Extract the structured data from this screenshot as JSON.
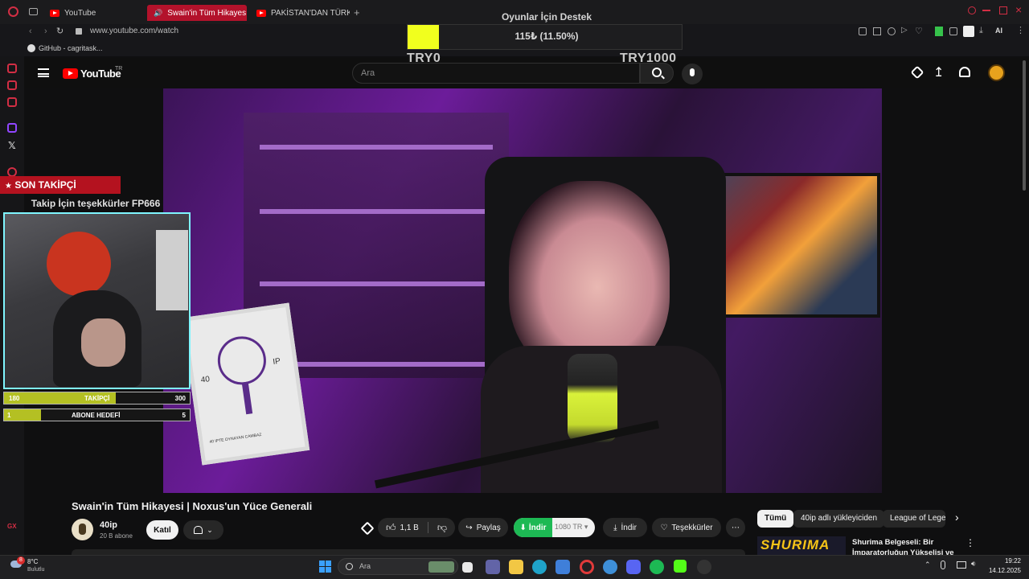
{
  "browser": {
    "tabs": [
      {
        "label": "YouTube"
      },
      {
        "label": "Swain'in Tüm Hikayes"
      },
      {
        "label": "PAKİSTAN'DAN TÜRKİYE"
      }
    ],
    "url": "www.youtube.com/watch",
    "bookmark": "GitHub - cagritask...",
    "ai_label": "AI"
  },
  "donation": {
    "title": "Oyunlar İçin Destek",
    "amount": "115₺ (11.50%)",
    "min_label": "TRY0",
    "max_label": "TRY1000",
    "progress": 0.115
  },
  "youtube": {
    "logo": "YouTube",
    "logo_suffix": "TR",
    "search_placeholder": "Ara"
  },
  "overlay": {
    "banner": "SON TAKİPÇİ",
    "message": "Takip İçin teşekkürler FP666",
    "followers_goal": {
      "current": "180",
      "label": "TAKİPÇİ",
      "target": "300",
      "progress": 0.6
    },
    "sub_goal": {
      "current": "1",
      "label": "ABONE HEDEFİ",
      "target": "5",
      "progress": 0.2
    }
  },
  "video": {
    "poster_left": "40",
    "poster_right": "IP",
    "poster_caption": "40 IPTE OYNAYAN CAMBAZ",
    "title": "Swain'in Tüm Hikayesi | Noxus'un Yüce Generali",
    "channel": "40ip",
    "subscribers": "20 B abone",
    "join_label": "Katıl",
    "likes": "1,1 B",
    "share_label": "Paylaş",
    "download_green": "İndir",
    "quality": "1080",
    "quality_lang": "TR",
    "download_label": "İndir",
    "thanks_label": "Teşekkürler"
  },
  "recommendations": {
    "chips": [
      "Tümü",
      "40ip adlı yükleyiciden",
      "League of Legen"
    ],
    "first_title_line1": "Shurima Belgeseli: Bir",
    "first_title_line2": "İmparatorluğun Yükselişi ve",
    "thumb_text": "SHURIMA"
  },
  "taskbar": {
    "weather_temp": "8°C",
    "weather_desc": "Bulutlu",
    "weather_badge": "8",
    "search_placeholder": "Ara",
    "time": "19:22",
    "date": "14.12.2025"
  },
  "colors": {
    "accent_red": "#ff0000",
    "opera_red": "#d22e44",
    "donation_yellow": "#f1ff1e",
    "download_green": "#1db954",
    "cam_border": "#7ff6ff"
  }
}
